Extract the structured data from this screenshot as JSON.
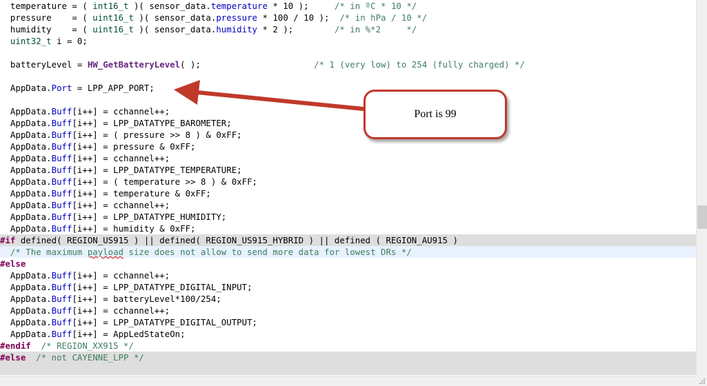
{
  "code_lines": [
    {
      "tokens": [
        [
          "",
          "  temperature = ( "
        ],
        [
          "typ",
          "int16_t"
        ],
        [
          "",
          " )( sensor_data."
        ],
        [
          "fld",
          "temperature"
        ],
        [
          "",
          " * 10 );     "
        ],
        [
          "cm",
          "/* in ºC * 10 */"
        ]
      ]
    },
    {
      "tokens": [
        [
          "",
          "  pressure    = ( "
        ],
        [
          "typ",
          "uint16_t"
        ],
        [
          "",
          " )( sensor_data."
        ],
        [
          "fld",
          "pressure"
        ],
        [
          "",
          " * 100 / 10 );  "
        ],
        [
          "cm",
          "/* in hPa / 10 */"
        ]
      ]
    },
    {
      "tokens": [
        [
          "",
          "  humidity    = ( "
        ],
        [
          "typ",
          "uint16_t"
        ],
        [
          "",
          " )( sensor_data."
        ],
        [
          "fld",
          "humidity"
        ],
        [
          "",
          " * 2 );        "
        ],
        [
          "cm",
          "/* in %*2     */"
        ]
      ]
    },
    {
      "tokens": [
        [
          "typ",
          "  uint32_t"
        ],
        [
          "",
          " i = 0;"
        ]
      ]
    },
    {
      "tokens": []
    },
    {
      "tokens": [
        [
          "",
          "  batteryLevel = "
        ],
        [
          "fn",
          "HW_GetBatteryLevel"
        ],
        [
          "",
          "( );                      "
        ],
        [
          "cm",
          "/* 1 (very low) to 254 (fully charged) */"
        ]
      ]
    },
    {
      "tokens": []
    },
    {
      "tokens": [
        [
          "",
          "  AppData."
        ],
        [
          "fld",
          "Port"
        ],
        [
          "",
          " = LPP_APP_PORT;"
        ]
      ]
    },
    {
      "tokens": []
    },
    {
      "tokens": [
        [
          "",
          "  AppData."
        ],
        [
          "fld",
          "Buff"
        ],
        [
          "",
          "[i++] = cchannel++;"
        ]
      ]
    },
    {
      "tokens": [
        [
          "",
          "  AppData."
        ],
        [
          "fld",
          "Buff"
        ],
        [
          "",
          "[i++] = LPP_DATATYPE_BAROMETER;"
        ]
      ]
    },
    {
      "tokens": [
        [
          "",
          "  AppData."
        ],
        [
          "fld",
          "Buff"
        ],
        [
          "",
          "[i++] = ( pressure >> 8 ) & 0xFF;"
        ]
      ]
    },
    {
      "tokens": [
        [
          "",
          "  AppData."
        ],
        [
          "fld",
          "Buff"
        ],
        [
          "",
          "[i++] = pressure & 0xFF;"
        ]
      ]
    },
    {
      "tokens": [
        [
          "",
          "  AppData."
        ],
        [
          "fld",
          "Buff"
        ],
        [
          "",
          "[i++] = cchannel++;"
        ]
      ]
    },
    {
      "tokens": [
        [
          "",
          "  AppData."
        ],
        [
          "fld",
          "Buff"
        ],
        [
          "",
          "[i++] = LPP_DATATYPE_TEMPERATURE;"
        ]
      ]
    },
    {
      "tokens": [
        [
          "",
          "  AppData."
        ],
        [
          "fld",
          "Buff"
        ],
        [
          "",
          "[i++] = ( temperature >> 8 ) & 0xFF;"
        ]
      ]
    },
    {
      "tokens": [
        [
          "",
          "  AppData."
        ],
        [
          "fld",
          "Buff"
        ],
        [
          "",
          "[i++] = temperature & 0xFF;"
        ]
      ]
    },
    {
      "tokens": [
        [
          "",
          "  AppData."
        ],
        [
          "fld",
          "Buff"
        ],
        [
          "",
          "[i++] = cchannel++;"
        ]
      ]
    },
    {
      "tokens": [
        [
          "",
          "  AppData."
        ],
        [
          "fld",
          "Buff"
        ],
        [
          "",
          "[i++] = LPP_DATATYPE_HUMIDITY;"
        ]
      ]
    },
    {
      "tokens": [
        [
          "",
          "  AppData."
        ],
        [
          "fld",
          "Buff"
        ],
        [
          "",
          "[i++] = humidity & 0xFF;"
        ]
      ]
    },
    {
      "style": "inactive",
      "tokens": [
        [
          "pp",
          "#if"
        ],
        [
          "",
          " defined( REGION_US915 ) || defined( REGION_US915_HYBRID ) || defined ( REGION_AU915 )"
        ]
      ]
    },
    {
      "style": "current",
      "tokens": [
        [
          "cm",
          "  /* The maximum "
        ],
        [
          "cm squig",
          "payload"
        ],
        [
          "cm",
          " size does not allow to send more data for lowest DRs */"
        ]
      ]
    },
    {
      "tokens": [
        [
          "pp",
          "#else"
        ]
      ]
    },
    {
      "tokens": [
        [
          "",
          "  AppData."
        ],
        [
          "fld",
          "Buff"
        ],
        [
          "",
          "[i++] = cchannel++;"
        ]
      ]
    },
    {
      "tokens": [
        [
          "",
          "  AppData."
        ],
        [
          "fld",
          "Buff"
        ],
        [
          "",
          "[i++] = LPP_DATATYPE_DIGITAL_INPUT;"
        ]
      ]
    },
    {
      "tokens": [
        [
          "",
          "  AppData."
        ],
        [
          "fld",
          "Buff"
        ],
        [
          "",
          "[i++] = batteryLevel*100/254;"
        ]
      ]
    },
    {
      "tokens": [
        [
          "",
          "  AppData."
        ],
        [
          "fld",
          "Buff"
        ],
        [
          "",
          "[i++] = cchannel++;"
        ]
      ]
    },
    {
      "tokens": [
        [
          "",
          "  AppData."
        ],
        [
          "fld",
          "Buff"
        ],
        [
          "",
          "[i++] = LPP_DATATYPE_DIGITAL_OUTPUT;"
        ]
      ]
    },
    {
      "tokens": [
        [
          "",
          "  AppData."
        ],
        [
          "fld",
          "Buff"
        ],
        [
          "",
          "[i++] = AppLedStateOn;"
        ]
      ]
    },
    {
      "tokens": [
        [
          "pp",
          "#endif"
        ],
        [
          "cm",
          "  /* REGION_XX915 */"
        ]
      ]
    },
    {
      "style": "inactive",
      "tokens": [
        [
          "pp",
          "#else"
        ],
        [
          "cm",
          "  /* not CAYENNE_LPP */"
        ]
      ]
    },
    {
      "style": "inactive",
      "tokens": []
    }
  ],
  "callout": {
    "text": "Port is 99"
  },
  "colors": {
    "callout_border": "#c0392b",
    "arrow": "#c0392b",
    "inactive_bg": "#dedede",
    "current_line_bg": "#e8f2fe"
  },
  "icons": {
    "grip": "resize-grip-icon",
    "arrow": "annotation-arrow-icon"
  }
}
